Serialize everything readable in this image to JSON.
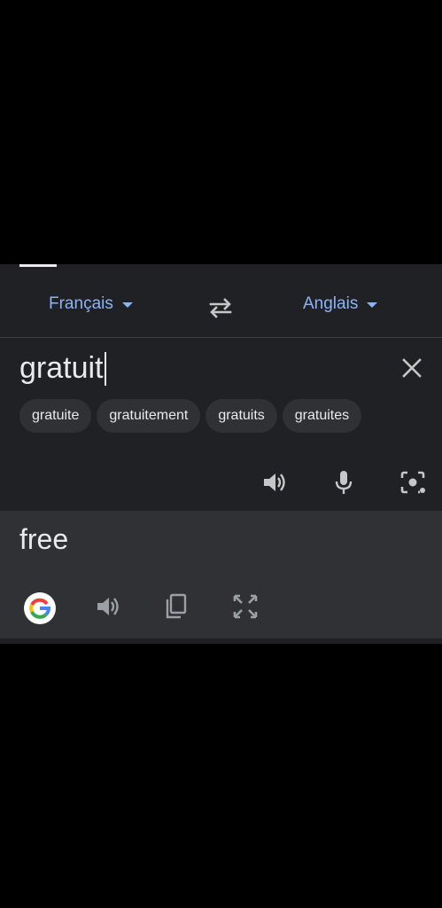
{
  "languages": {
    "source": "Français",
    "target": "Anglais"
  },
  "input": {
    "text": "gratuit"
  },
  "suggestions": [
    "gratuite",
    "gratuitement",
    "gratuits",
    "gratuites"
  ],
  "output": {
    "text": "free"
  },
  "icons": {
    "swap": "swap-languages-icon",
    "clear": "close-icon",
    "speaker": "speaker-icon",
    "mic": "microphone-icon",
    "camera": "camera-icon",
    "google": "google-logo-icon",
    "copy": "copy-icon",
    "fullscreen": "fullscreen-icon"
  },
  "colors": {
    "accent": "#8ab4f8",
    "panel": "#202124",
    "output_bg": "#303134",
    "text": "#e8eaed"
  }
}
